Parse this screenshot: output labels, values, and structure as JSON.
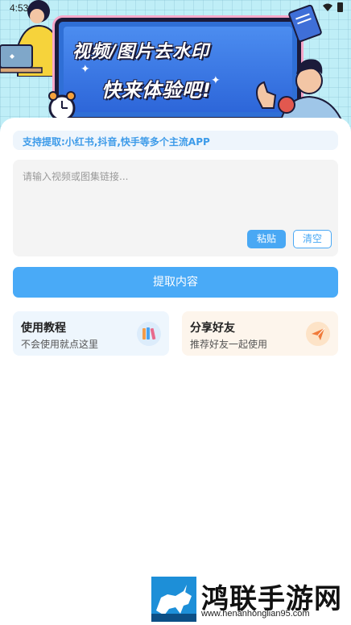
{
  "status_bar": {
    "time": "4:53"
  },
  "banner": {
    "title_line1": "视频/图片去水印",
    "title_line2": "快来体验吧!"
  },
  "support_text": "支持提取:小红书,抖音,快手等多个主流APP",
  "input": {
    "placeholder": "请输入视频或图集链接..."
  },
  "buttons": {
    "paste": "粘贴",
    "clear": "清空",
    "extract": "提取内容"
  },
  "features": [
    {
      "title": "使用教程",
      "subtitle": "不会使用就点这里",
      "icon": "books-icon"
    },
    {
      "title": "分享好友",
      "subtitle": "推荐好友一起使用",
      "icon": "paper-plane-icon"
    }
  ],
  "watermark": {
    "name": "鸿联手游网",
    "url": "www.henanhonglian95.com"
  },
  "colors": {
    "accent": "#49aaf7",
    "support_text": "#3d9be9",
    "banner_bg": "#bfeef7"
  }
}
